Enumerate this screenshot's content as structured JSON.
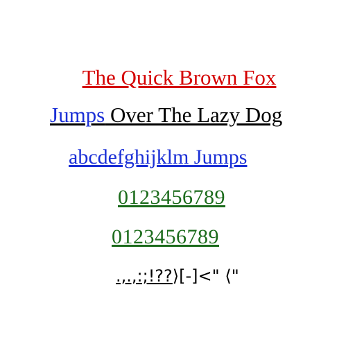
{
  "lines": {
    "line1": "The Quick Brown Fox",
    "line2_link": "Jumps",
    "line2_rest": " Over The Lazy Dog",
    "line3": "abcdefghijklm Jumps",
    "line4": "0123456789",
    "line5": "0123456789",
    "line6_underlined": ".,.,:;!??",
    "line6_rest": "⟩[-]<\" ⟨\""
  },
  "colors": {
    "red": "#d40000",
    "blue": "#1a2fd6",
    "green": "#1b6b1b",
    "black": "#000000"
  }
}
